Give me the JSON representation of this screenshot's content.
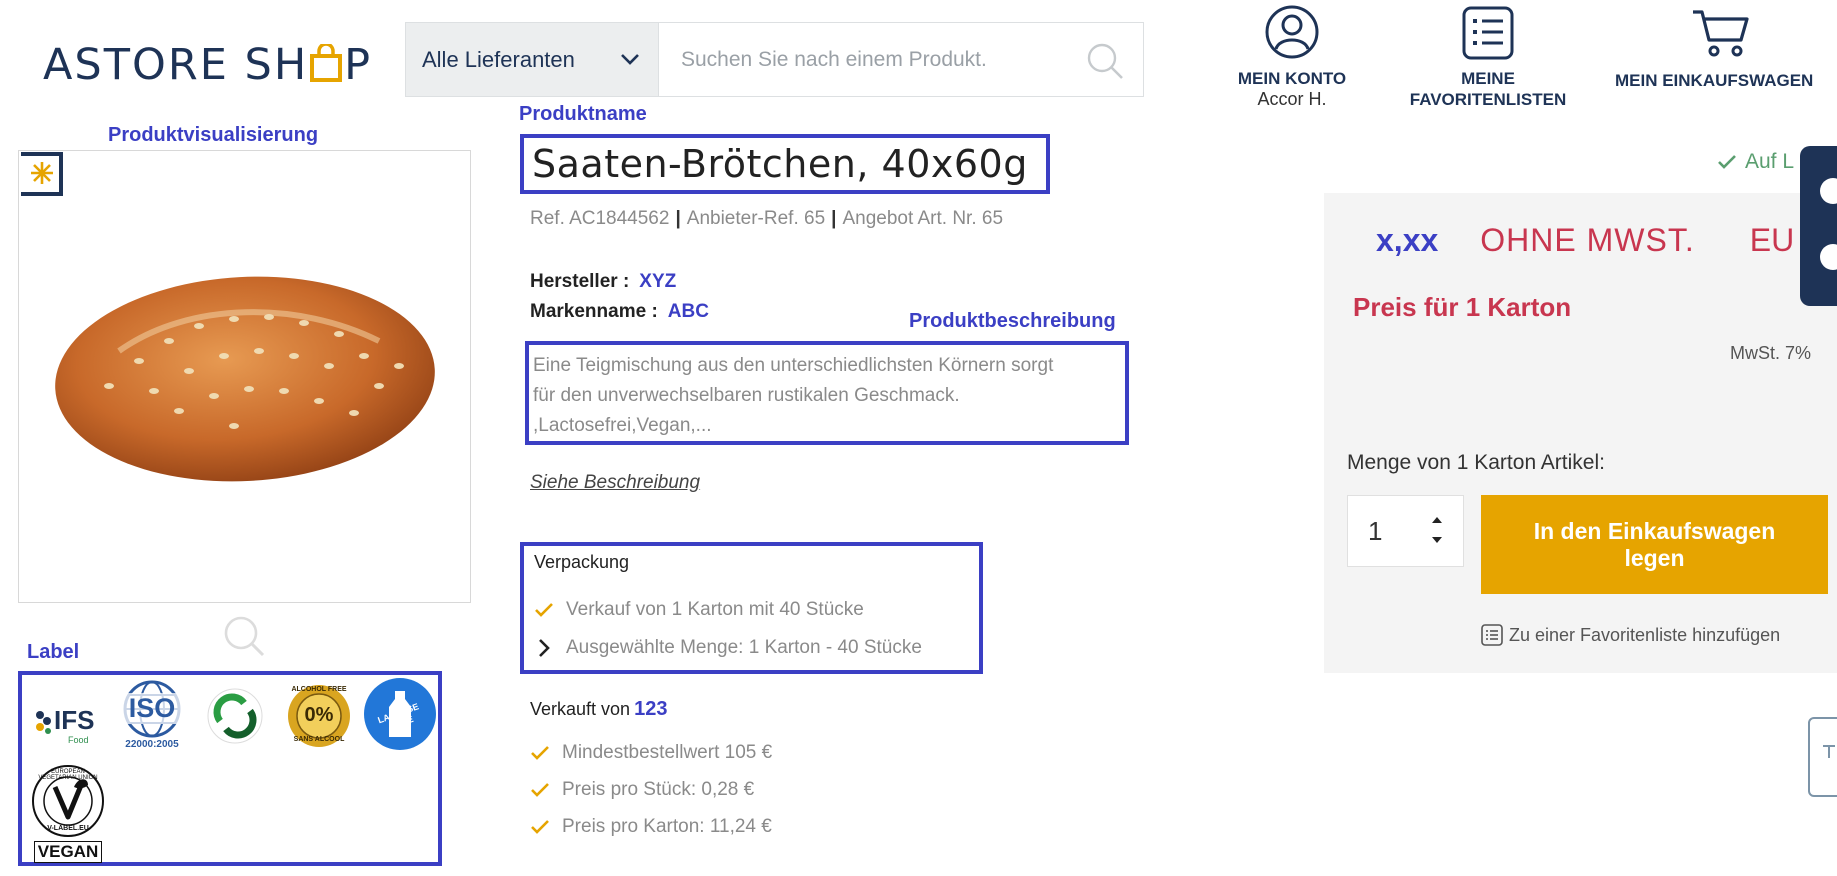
{
  "header": {
    "logo_left": "ASTORE SH",
    "logo_right": "P",
    "supplier_select": "Alle Lieferanten",
    "search_placeholder": "Suchen Sie nach einem Produkt.",
    "account_label": "MEIN KONTO",
    "account_user": "Accor H.",
    "favorites_line1": "MEINE",
    "favorites_line2": "FAVORITENLISTEN",
    "cart_label": "MEIN EINKAUFSWAGEN"
  },
  "annotations": {
    "visual": "Produktvisualisierung",
    "name": "Produktname",
    "description": "Produktbeschreibung",
    "label": "Label"
  },
  "product": {
    "title": "Saaten-Brötchen, 40x60g",
    "ref": "Ref. AC1844562",
    "supplier_ref": "Anbieter-Ref. 65",
    "offer_nr": "Angebot Art. Nr. 65",
    "manufacturer_label": "Hersteller :",
    "manufacturer": "XYZ",
    "brand_label": "Markenname :",
    "brand": "ABC",
    "description_line1": "Eine Teigmischung aus den unterschiedlichsten Körnern sorgt",
    "description_line2": "für den unverwechselbaren rustikalen Geschmack.",
    "description_line3": ",Lactosefrei,Vegan,...",
    "see_description": "Siehe Beschreibung",
    "packaging_title": "Verpackung",
    "packaging_sale": "Verkauf von 1 Karton mit 40 Stücke",
    "packaging_selected": "Ausgewählte Menge: 1 Karton - 40 Stücke",
    "sold_by_label": "Verkauft von",
    "sold_by": "123",
    "min_order": "Mindestbestellwert 105 €",
    "price_per_piece": "Preis pro Stück: 0,28 €",
    "price_per_carton": "Preis pro Karton: 11,24 €"
  },
  "labels": {
    "ifs": "IFS",
    "ifs_sub": "Food",
    "iso": "ISO",
    "iso_sub": "22000:2005",
    "alcohol_top": "ALCOHOL FREE",
    "alcohol_mid": "0%",
    "alcohol_bottom": "SANS ALCOOL",
    "lactose": "LACTOSE FREE",
    "vegan_ring": "EUROPEAN VEGETARIAN UNION",
    "vegan_url": "V-LABEL.EU",
    "vegan": "VEGAN"
  },
  "pricing": {
    "availability": "Auf L",
    "price": "x,xx",
    "tax_label": "OHNE MWST.",
    "currency": "EU",
    "price_for": "Preis für 1 Karton",
    "vat": "MwSt. 7%",
    "quantity_label": "Menge von 1 Karton Artikel:",
    "quantity": "1",
    "cart_button_line1": "In den Einkaufswagen",
    "cart_button_line2": "legen",
    "favorite_link": "Zu einer Favoritenliste hinzufügen"
  },
  "colors": {
    "navy": "#1e3356",
    "annotation_blue": "#3b3fc4",
    "price_red": "#c8364f",
    "button_gold": "#e6a400",
    "check_orange": "#e6a400",
    "available_green": "#5a9e6f"
  }
}
